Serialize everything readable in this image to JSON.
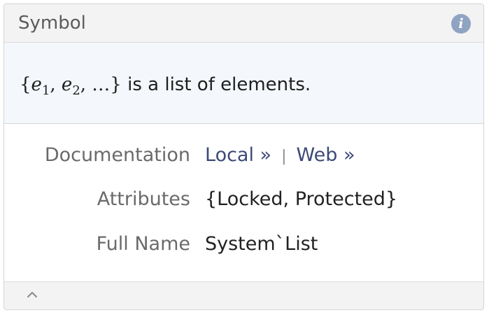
{
  "panel": {
    "title": "Symbol",
    "info_icon": "info-icon",
    "info_glyph": "i"
  },
  "usage": {
    "brace_open": "{",
    "e": "e",
    "sub1": "1",
    "sub2": "2",
    "comma": ",",
    "ellipsis": "…",
    "brace_close": "}",
    "description": "is a list of elements."
  },
  "details": {
    "documentation": {
      "label": "Documentation",
      "local": "Local »",
      "separator": "|",
      "web": "Web »"
    },
    "attributes": {
      "label": "Attributes",
      "value": "{Locked, Protected}"
    },
    "full_name": {
      "label": "Full Name",
      "value": "System`List"
    }
  },
  "footer": {
    "collapse_icon": "chevron-up-icon"
  },
  "colors": {
    "header_bg": "#f3f3f3",
    "usage_bg": "#f4f7fb",
    "info_icon": "#8fa3c2",
    "link": "#3d4a78"
  }
}
